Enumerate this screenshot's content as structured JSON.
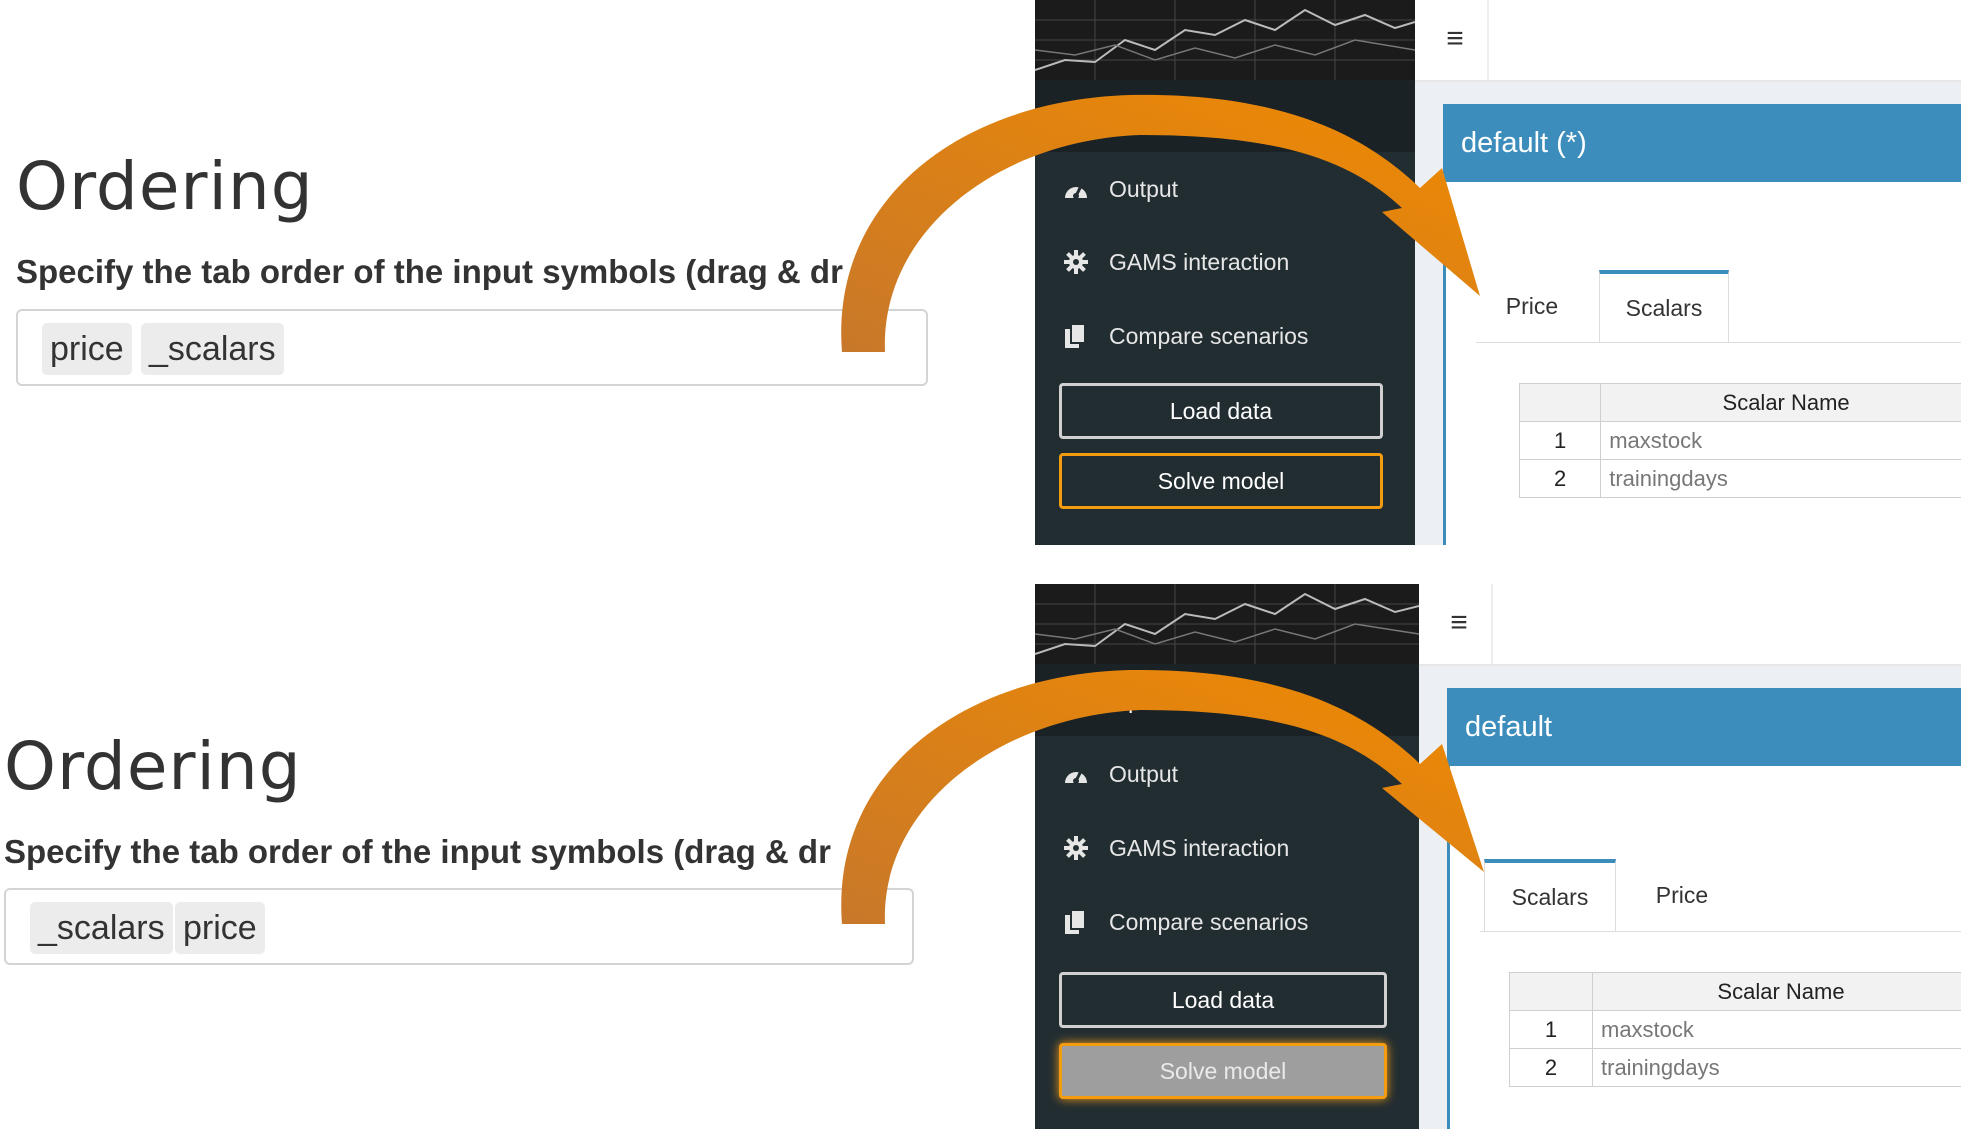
{
  "panels": [
    {
      "ordering": {
        "title": "Ordering",
        "description": "Specify the tab order of the input symbols (drag & dr",
        "description_end": ")",
        "chips": [
          "price",
          "_scalars"
        ]
      },
      "app": {
        "hamburger": "≡",
        "sidebar": {
          "items": [
            {
              "label": "Input",
              "icon": "grid-icon"
            },
            {
              "label": "Output",
              "icon": "dashboard-icon"
            },
            {
              "label": "GAMS interaction",
              "icon": "gear-icon"
            },
            {
              "label": "Compare scenarios",
              "icon": "copy-icon"
            }
          ],
          "load_label": "Load data",
          "solve_label": "Solve model"
        },
        "scenario_title": "default (*)",
        "tabs": [
          "Price",
          "Scalars"
        ],
        "active_tab": "Scalars",
        "table": {
          "header": "Scalar Name",
          "rows": [
            {
              "n": "1",
              "name": "maxstock"
            },
            {
              "n": "2",
              "name": "trainingdays"
            }
          ]
        }
      }
    },
    {
      "ordering": {
        "title": "Ordering",
        "description": "Specify the tab order of the input symbols (drag & dr",
        "description_end": ")",
        "chips": [
          "_scalars",
          "price"
        ]
      },
      "app": {
        "hamburger": "≡",
        "sidebar": {
          "items": [
            {
              "label": "Input",
              "icon": "grid-icon"
            },
            {
              "label": "Output",
              "icon": "dashboard-icon"
            },
            {
              "label": "GAMS interaction",
              "icon": "gear-icon"
            },
            {
              "label": "Compare scenarios",
              "icon": "copy-icon"
            }
          ],
          "load_label": "Load data",
          "solve_label": "Solve model"
        },
        "scenario_title": "default",
        "tabs": [
          "Scalars",
          "Price"
        ],
        "active_tab": "Scalars",
        "table": {
          "header": "Scalar Name",
          "rows": [
            {
              "n": "1",
              "name": "maxstock"
            },
            {
              "n": "2",
              "name": "trainingdays"
            }
          ]
        }
      }
    }
  ],
  "colors": {
    "accent_blue": "#3c8dbc",
    "sidebar_bg": "#222d32",
    "arrow_orange": "#e8870f",
    "solve_border": "#f39c12"
  }
}
